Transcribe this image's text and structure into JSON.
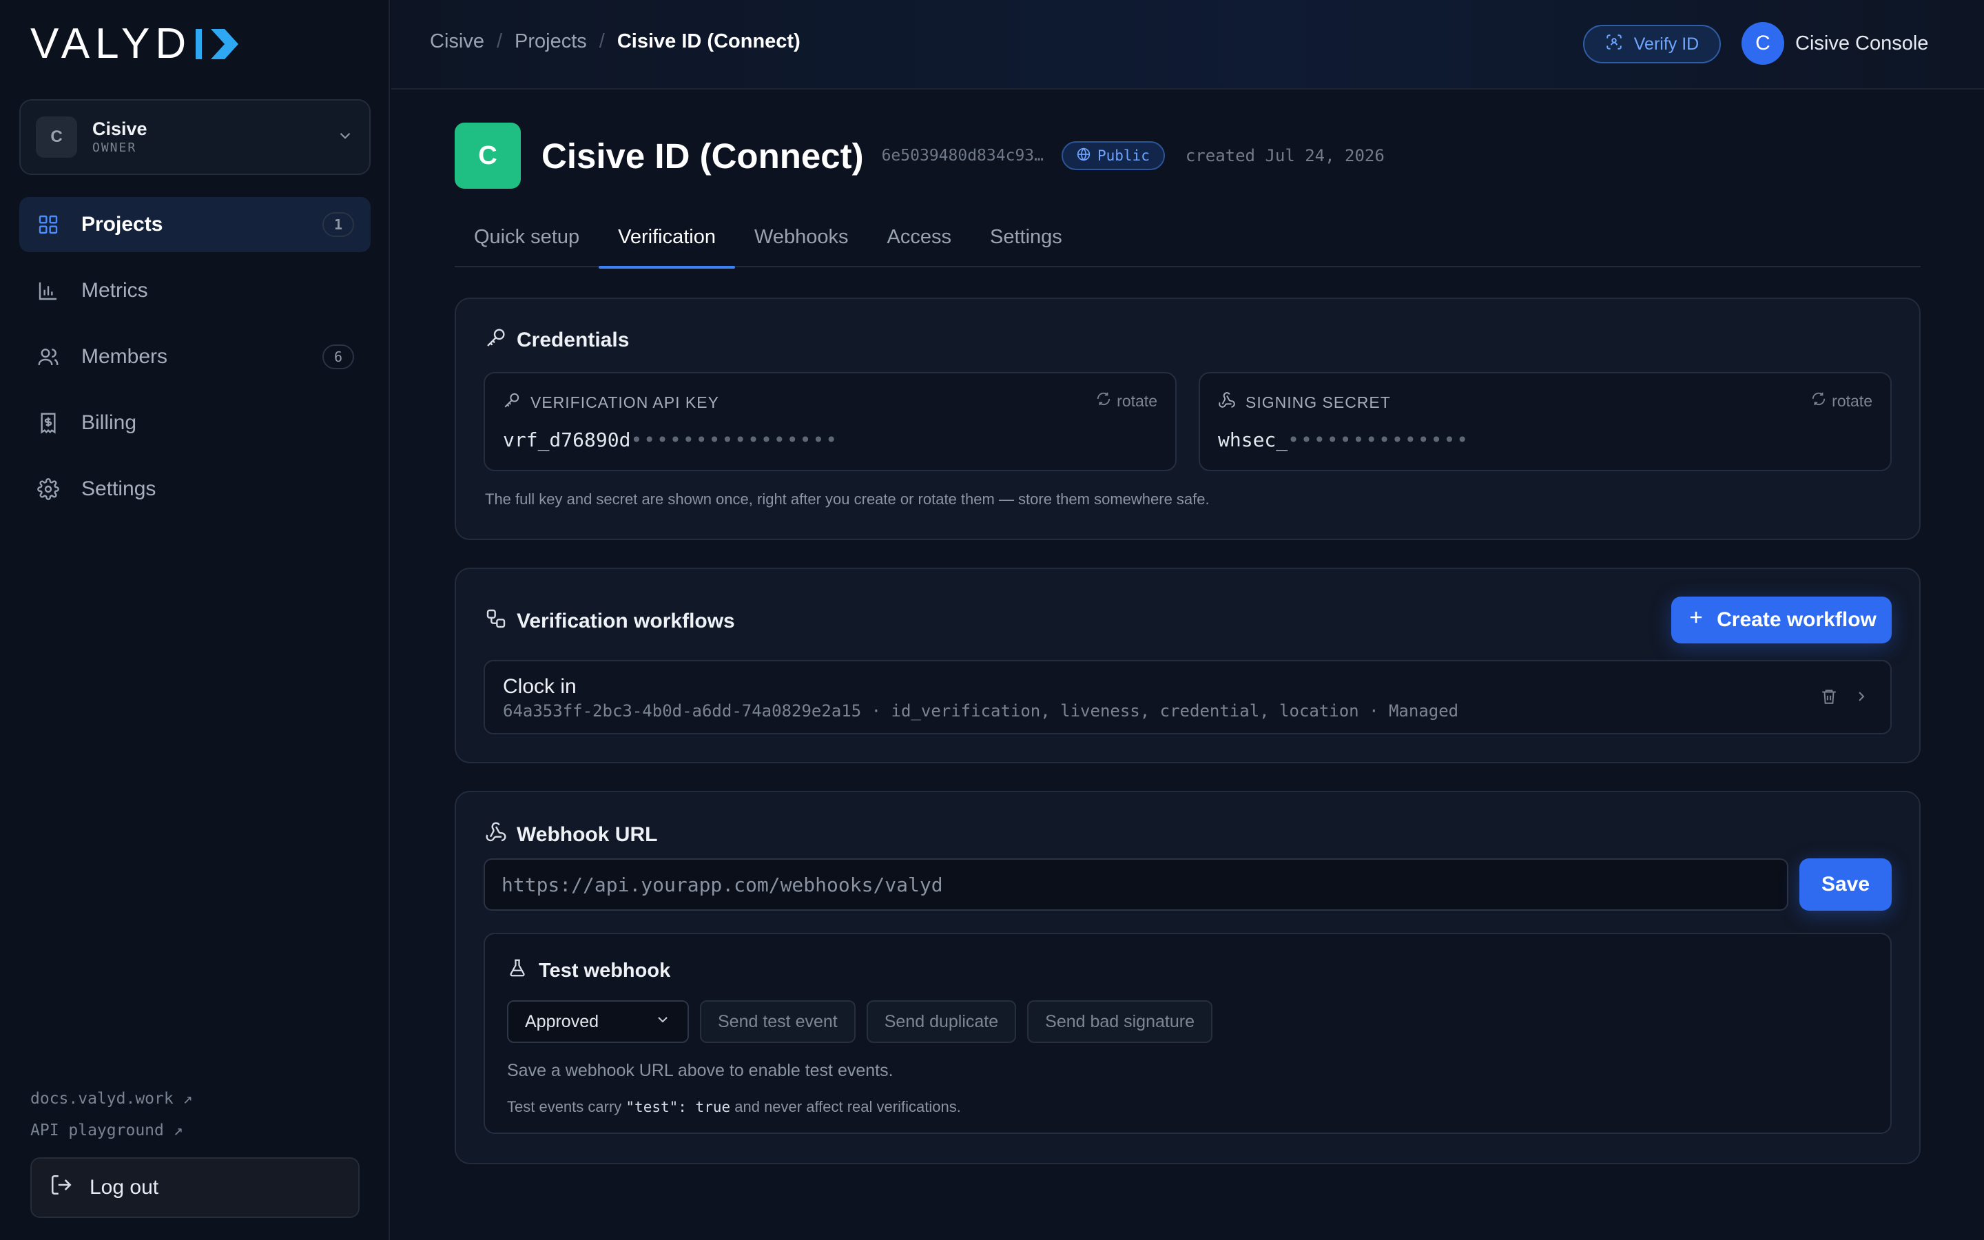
{
  "app": {
    "logo_text": "VALYD",
    "colors": {
      "accent": "#2f6bf0",
      "logo_mark": "#2ea8f2",
      "project_avatar": "#1fbf83",
      "background": "#0c1220"
    }
  },
  "sidebar": {
    "org": {
      "initial": "C",
      "name": "Cisive",
      "role": "OWNER"
    },
    "items": [
      {
        "label": "Projects",
        "icon": "grid-icon",
        "badge": "1",
        "active": true
      },
      {
        "label": "Metrics",
        "icon": "bar-chart-icon",
        "badge": "",
        "active": false
      },
      {
        "label": "Members",
        "icon": "users-icon",
        "badge": "6",
        "active": false
      },
      {
        "label": "Billing",
        "icon": "receipt-dollar-icon",
        "badge": "",
        "active": false
      },
      {
        "label": "Settings",
        "icon": "gear-icon",
        "badge": "",
        "active": false
      }
    ],
    "links": [
      {
        "label": "docs.valyd.work ↗"
      },
      {
        "label": "API playground ↗"
      }
    ],
    "logout_label": "Log out"
  },
  "header": {
    "breadcrumbs": [
      {
        "label": "Cisive"
      },
      {
        "label": "Projects"
      },
      {
        "label": "Cisive ID (Connect)"
      }
    ],
    "separator": "/",
    "verify_label": "Verify ID",
    "user": {
      "initial": "C",
      "name": "Cisive Console"
    }
  },
  "project": {
    "initial": "C",
    "title": "Cisive ID (Connect)",
    "id": "6e5039480d834c93…",
    "visibility": "Public",
    "created": "created Jul 24, 2026"
  },
  "tabs": [
    {
      "label": "Quick setup",
      "active": false
    },
    {
      "label": "Verification",
      "active": true
    },
    {
      "label": "Webhooks",
      "active": false
    },
    {
      "label": "Access",
      "active": false
    },
    {
      "label": "Settings",
      "active": false
    }
  ],
  "credentials": {
    "title": "Credentials",
    "api_key": {
      "label": "VERIFICATION API KEY",
      "rotate": "rotate",
      "prefix": "vrf_d76890d",
      "mask": "••••••••••••••••"
    },
    "signing_secret": {
      "label": "SIGNING SECRET",
      "rotate": "rotate",
      "prefix": "whsec_",
      "mask": "••••••••••••••"
    },
    "note": "The full key and secret are shown once, right after you create or rotate them — store them somewhere safe."
  },
  "workflows": {
    "title": "Verification workflows",
    "create_label": "Create workflow",
    "items": [
      {
        "name": "Clock in",
        "meta": "64a353ff-2bc3-4b0d-a6dd-74a0829e2a15 · id_verification, liveness, credential, location · Managed"
      }
    ]
  },
  "webhook": {
    "title": "Webhook URL",
    "url_value": "",
    "url_placeholder": "https://api.yourapp.com/webhooks/valyd",
    "save_label": "Save",
    "test": {
      "title": "Test webhook",
      "selected_event": "Approved",
      "send_test": "Send test event",
      "send_duplicate": "Send duplicate",
      "send_bad_signature": "Send bad signature",
      "hint": "Save a webhook URL above to enable test events.",
      "note_prefix": "Test events carry",
      "note_code": "\"test\": true",
      "note_suffix": "and never affect real verifications."
    }
  }
}
